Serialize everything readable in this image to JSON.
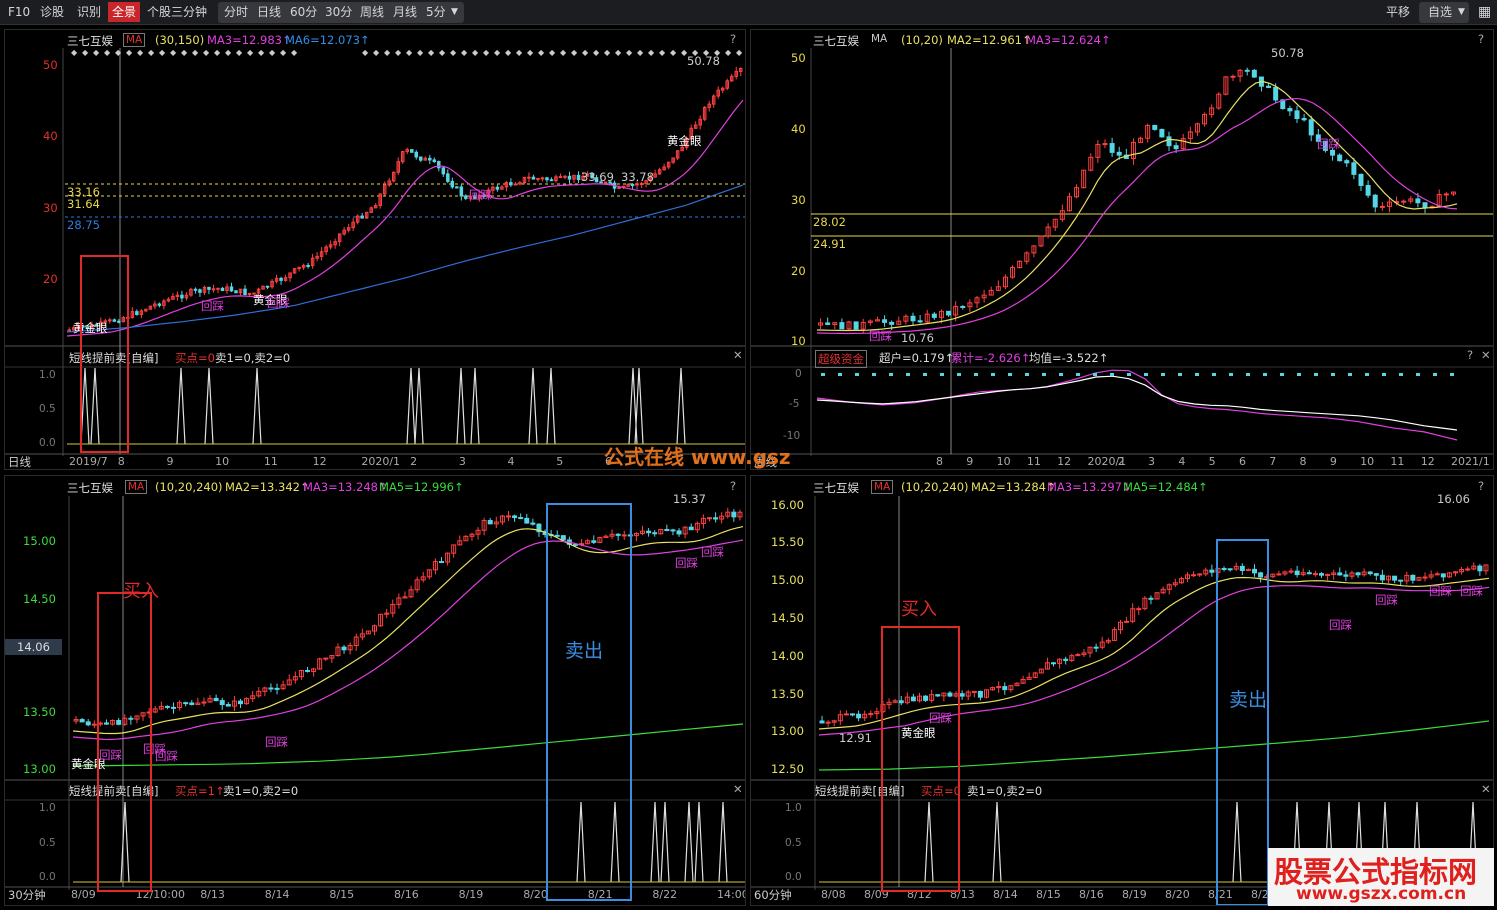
{
  "toolbar": {
    "f10": "F10",
    "diag": "诊股",
    "recog": "识别",
    "full": "全景",
    "stock3m": "个股三分钟",
    "periods": [
      "分时",
      "日线",
      "60分",
      "30分",
      "周线",
      "月线",
      "5分"
    ],
    "flat": "平移",
    "custom": "自选"
  },
  "panels": {
    "tl": {
      "stock": "三七互娱",
      "ind": "MA",
      "params": "(30,150)",
      "ma3": "MA3=12.983↑",
      "ma6": "MA6=12.073↑",
      "ylabels": [
        "50",
        "40",
        "30",
        "20"
      ],
      "levels": [
        {
          "v": "33.16",
          "c": "#e8d84a"
        },
        {
          "v": "31.64",
          "c": "#e8d84a"
        },
        {
          "v": "28.75",
          "c": "#2f7de1"
        }
      ],
      "hi": "50.78",
      "annos": [
        "黄金眼",
        "黄金眼",
        "黄金眼",
        "回踩",
        "回踩",
        "33.69",
        "33.78",
        "回踩"
      ],
      "sub": {
        "name": "短线提前卖[自编]",
        "buy": "买点=0",
        "rest": "卖1=0,卖2=0",
        "ylabels": [
          "1.0",
          "0.5",
          "0.0"
        ]
      },
      "period": "日线",
      "xlabels": [
        "2019/7",
        "8",
        "9",
        "10",
        "11",
        "12",
        "2020/1",
        "2",
        "3",
        "4",
        "5",
        "6"
      ]
    },
    "tr": {
      "stock": "三七互娱",
      "ind": "MA",
      "params": "(10,20)",
      "ma2": "MA2=12.961↑",
      "ma3": "MA3=12.624↑",
      "ylabels": [
        "50",
        "40",
        "30",
        "20",
        "10"
      ],
      "levels": [
        {
          "v": "28.02",
          "c": "#e8d84a"
        },
        {
          "v": "24.91",
          "c": "#e8d84a"
        }
      ],
      "hi": "50.78",
      "lo": "10.76",
      "annos": [
        "回踩",
        "回踩"
      ],
      "sub": {
        "name": "超级资金",
        "a": "超户=0.179↑",
        "b": "累计=-2.626↑",
        "c": "均值=-3.522↑",
        "ylabels": [
          "0",
          "-5",
          "-10"
        ]
      },
      "period": "周线",
      "xlabels": [
        "8",
        "9",
        "10",
        "11",
        "12",
        "2020/1",
        "2",
        "3",
        "4",
        "5",
        "6",
        "7",
        "8",
        "9",
        "10",
        "11",
        "12",
        "2021/1"
      ]
    },
    "bl": {
      "stock": "三七互娱",
      "ind": "MA",
      "params": "(10,20,240)",
      "ma2": "MA2=13.342↑",
      "ma3": "MA3=13.248↑",
      "ma5": "MA5=12.996↑",
      "ylabels": [
        "15.00",
        "14.50",
        "14.00",
        "13.50",
        "13.00"
      ],
      "crosshair": "14.06",
      "hi": "15.37",
      "buy": "买入",
      "sell": "卖出",
      "annos": [
        "黄金眼",
        "回踩",
        "回踩",
        "回踩",
        "回踩",
        "回踩",
        "回踩"
      ],
      "sub": {
        "name": "短线提前卖[自编]",
        "buy": "买点=1↑",
        "rest": "卖1=0,卖2=0",
        "ylabels": [
          "1.0",
          "0.5",
          "0.0"
        ]
      },
      "period": "30分钟",
      "xlabels": [
        "8/09",
        "12/10:00",
        "8/13",
        "8/14",
        "8/15",
        "8/16",
        "8/19",
        "8/20",
        "8/21",
        "8/22",
        "14:00"
      ]
    },
    "br": {
      "stock": "三七互娱",
      "ind": "MA",
      "params": "(10,20,240)",
      "ma2": "MA2=13.284↑",
      "ma3": "MA3=13.297↓",
      "ma5": "MA5=12.484↑",
      "ylabels": [
        "16.00",
        "15.50",
        "15.00",
        "14.50",
        "14.00",
        "13.50",
        "13.00",
        "12.50"
      ],
      "hi": "16.06",
      "lo": "12.91",
      "buy": "买入",
      "sell": "卖出",
      "annos": [
        "黄金眼",
        "回踩",
        "回踩",
        "回踩",
        "回踩",
        "回踩"
      ],
      "sub": {
        "name": "短线提前卖[自编]",
        "buy": "买点=0",
        "rest": "卖1=0,卖2=0",
        "ylabels": [
          "1.0",
          "0.5",
          "0.0"
        ]
      },
      "period": "60分钟",
      "xlabels": [
        "8/08",
        "8/09",
        "8/12",
        "8/13",
        "8/14",
        "8/15",
        "8/16",
        "8/19",
        "8/20",
        "8/21",
        "8/2"
      ]
    }
  },
  "watermark1": "公式在线 www.gsz",
  "watermark2": {
    "title": "股票公式指标网",
    "url": "www.gszx.com.cn"
  },
  "colors": {
    "up": "#ff4040",
    "down": "#54d6e6",
    "ma_yellow": "#e8e060",
    "ma_pink": "#e040e0",
    "ma_blue": "#2f6fd6",
    "ma_green": "#3cdc3c",
    "buy_box": "#e02a2a",
    "sell_box": "#3a8ee0"
  }
}
